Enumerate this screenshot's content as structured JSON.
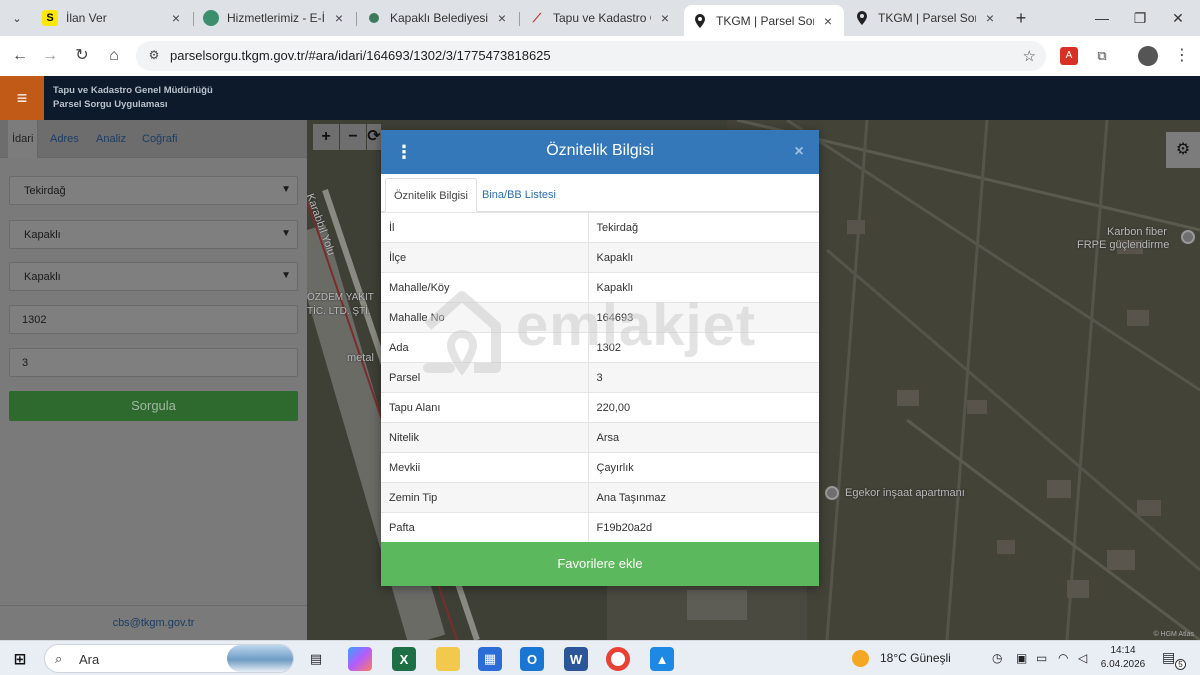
{
  "browser": {
    "tabs": [
      {
        "title": "İlan Ver",
        "favicon": "S"
      },
      {
        "title": "Hizmetlerimiz - E-İmar",
        "favicon": "globe"
      },
      {
        "title": "Kapaklı Belediyesi CBS",
        "favicon": "globe"
      },
      {
        "title": "Tapu ve Kadastro Genel",
        "favicon": "tkgm"
      },
      {
        "title": "TKGM | Parsel Sorgu Uygulaması",
        "favicon": "pin",
        "active": true
      },
      {
        "title": "TKGM | Parsel Sorgu Uygulaması",
        "favicon": "pin"
      }
    ],
    "url": "parselsorgu.tkgm.gov.tr/#ara/idari/164693/1302/3/1775473818625"
  },
  "app": {
    "title_line1": "Tapu ve Kadastro Genel Müdürlüğü",
    "title_line2": "Parsel Sorgu Uygulaması"
  },
  "left_panel": {
    "tabs": [
      "İdari",
      "Adres",
      "Analiz",
      "Coğrafi"
    ],
    "il": "Tekirdağ",
    "ilce": "Kapaklı",
    "mahalle": "Kapaklı",
    "ada": "1302",
    "parsel": "3",
    "submit_label": "Sorgula",
    "footer_email": "cbs@tkgm.gov.tr"
  },
  "map": {
    "labels": {
      "road": "Karabbıl Yolu",
      "company1": "ÖZDEM YAKIT",
      "company2": "TİC. LTD. ŞTİ.",
      "metal": "metal",
      "karbon1": "Karbon fiber",
      "karbon2": "FRPE güçlendirme",
      "egekor": "Egekor inşaat apartmanı"
    },
    "attribution": "© HGM Atlas"
  },
  "modal": {
    "title": "Öznitelik Bilgisi",
    "tabs": [
      "Öznitelik Bilgisi",
      "Bina/BB Listesi"
    ],
    "rows": [
      {
        "key": "İl",
        "value": "Tekirdağ"
      },
      {
        "key": "İlçe",
        "value": "Kapaklı"
      },
      {
        "key": "Mahalle/Köy",
        "value": "Kapaklı"
      },
      {
        "key": "Mahalle No",
        "value": "164693"
      },
      {
        "key": "Ada",
        "value": "1302"
      },
      {
        "key": "Parsel",
        "value": "3"
      },
      {
        "key": "Tapu Alanı",
        "value": "220,00"
      },
      {
        "key": "Nitelik",
        "value": "Arsa"
      },
      {
        "key": "Mevkii",
        "value": "Çayırlık"
      },
      {
        "key": "Zemin Tip",
        "value": "Ana Taşınmaz"
      },
      {
        "key": "Pafta",
        "value": "F19b20a2d"
      }
    ],
    "favorite_label": "Favorilere ekle"
  },
  "watermark": "emlakjet",
  "taskbar": {
    "search_text": "Ara",
    "weather": "18°C  Güneşli",
    "time": "14:14",
    "date": "6.04.2026",
    "notifications": "5"
  },
  "colors": {
    "modal_header": "#3478b9",
    "favorite_button": "#5cb85c",
    "menu_button": "#c25a17",
    "app_header": "#0d1a2b"
  }
}
